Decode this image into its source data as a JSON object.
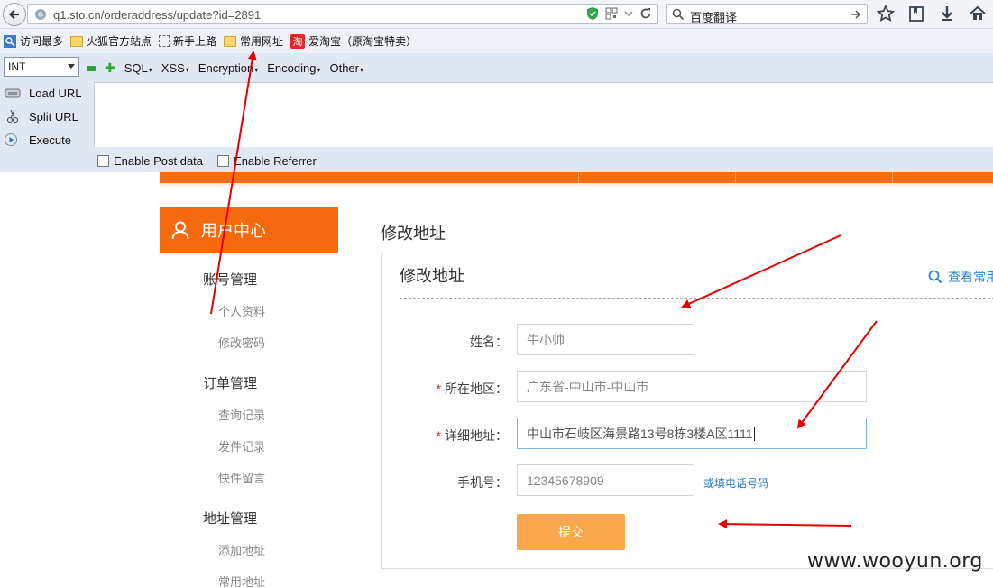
{
  "browser": {
    "url": "q1.sto.cn/orderaddress/update?id=2891",
    "search_text": "百度翻译",
    "bookmarks": [
      {
        "label": "访问最多",
        "icon": "globe-icon"
      },
      {
        "label": "火狐官方站点",
        "icon": "folder-icon"
      },
      {
        "label": "新手上路",
        "icon": "dotted-page-icon"
      },
      {
        "label": "常用网址",
        "icon": "folder-icon"
      },
      {
        "label": "爱淘宝（原淘宝特卖）",
        "icon": "taobao-icon"
      }
    ]
  },
  "hackbar": {
    "select_value": "INT",
    "menus": [
      "SQL",
      "XSS",
      "Encryption",
      "Encoding",
      "Other"
    ],
    "actions": [
      "Load URL",
      "Split URL",
      "Execute"
    ],
    "checkboxes": [
      "Enable Post data",
      "Enable Referrer"
    ]
  },
  "sidebar": {
    "header": "用户中心",
    "groups": [
      {
        "title": "账号管理",
        "items": [
          "个人资料",
          "修改密码"
        ]
      },
      {
        "title": "订单管理",
        "items": [
          "查询记录",
          "发件记录",
          "快件留言"
        ]
      },
      {
        "title": "地址管理",
        "items": [
          "添加地址",
          "常用地址"
        ]
      }
    ]
  },
  "main": {
    "heading": "修改地址",
    "form_title": "修改地址",
    "view_common_link": "查看常用",
    "fields": [
      {
        "label": "姓名：",
        "value": "牛小帅",
        "required": false
      },
      {
        "label": "所在地区：",
        "value": "广东省-中山市-中山市",
        "required": true
      },
      {
        "label": "详细地址：",
        "value": "中山市石岐区海景路13号8栋3楼A区1111",
        "required": true
      },
      {
        "label": "手机号：",
        "value": "12345678909",
        "required": false
      }
    ],
    "alt_phone_link": "或填电话号码",
    "submit_label": "提交"
  },
  "watermark": "www.wooyun.org",
  "colors": {
    "accent_orange": "#f56a0f",
    "submit": "#fba84c",
    "link": "#2b87d8",
    "annotation_arrow": "#e60000"
  }
}
